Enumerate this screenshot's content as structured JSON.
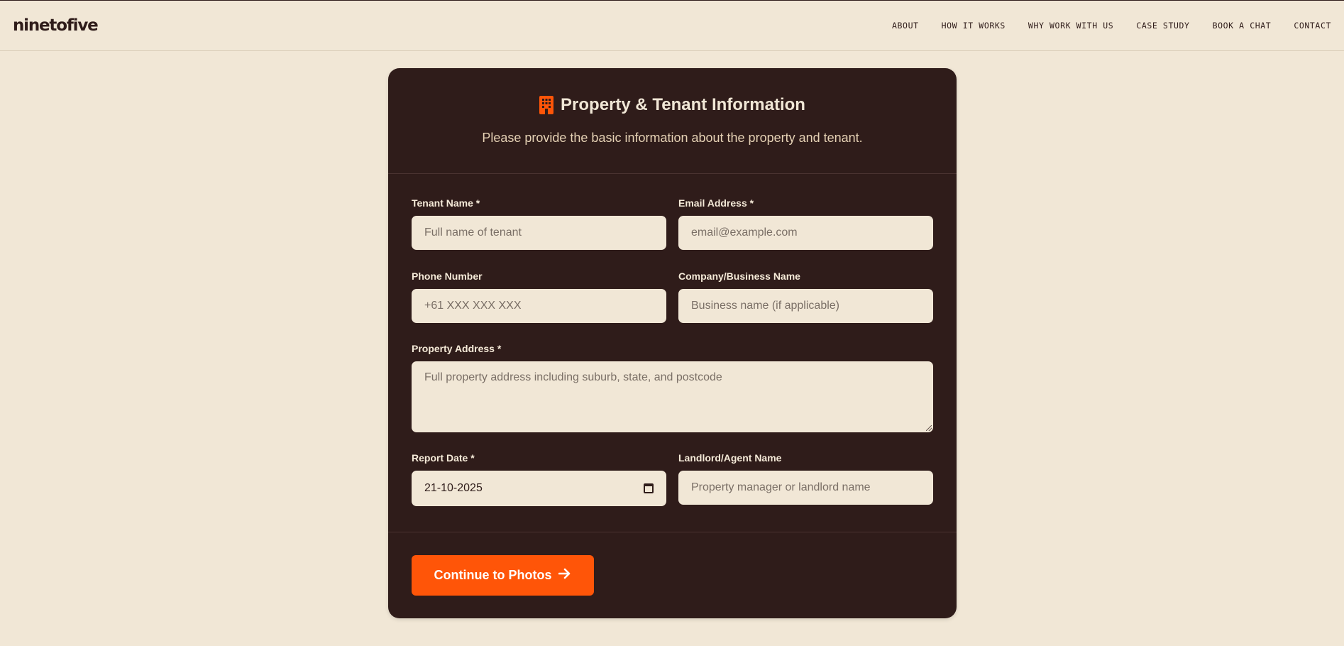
{
  "brand": {
    "logo": "ninetofive"
  },
  "nav": {
    "items": [
      "ABOUT",
      "HOW IT WORKS",
      "WHY WORK WITH US",
      "CASE STUDY",
      "BOOK A CHAT",
      "CONTACT"
    ]
  },
  "card": {
    "icon": "building-icon",
    "title": "Property & Tenant Information",
    "subtitle": "Please provide the basic information about the property and tenant."
  },
  "form": {
    "tenant_name": {
      "label": "Tenant Name *",
      "placeholder": "Full name of tenant",
      "value": ""
    },
    "email": {
      "label": "Email Address *",
      "placeholder": "email@example.com",
      "value": ""
    },
    "phone": {
      "label": "Phone Number",
      "placeholder": "+61 XXX XXX XXX",
      "value": ""
    },
    "company": {
      "label": "Company/Business Name",
      "placeholder": "Business name (if applicable)",
      "value": ""
    },
    "address": {
      "label": "Property Address *",
      "placeholder": "Full property address including suburb, state, and postcode",
      "value": ""
    },
    "report_date": {
      "label": "Report Date *",
      "value": "21-10-2025",
      "icon": "calendar-icon"
    },
    "landlord": {
      "label": "Landlord/Agent Name",
      "placeholder": "Property manager or landlord name",
      "value": ""
    }
  },
  "actions": {
    "continue_label": "Continue to Photos",
    "continue_icon": "arrow-right-icon"
  },
  "colors": {
    "background": "#f1e7d6",
    "card": "#2f1c1a",
    "accent": "#ff5508",
    "input_bg": "#f1e7d6"
  }
}
